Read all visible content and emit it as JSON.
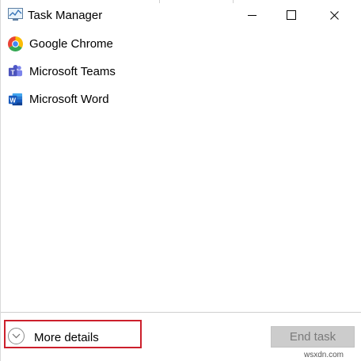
{
  "window": {
    "title": "Task Manager",
    "icon": "task-manager-icon"
  },
  "processes": [
    {
      "label": "Google Chrome",
      "icon": "chrome-icon"
    },
    {
      "label": "Microsoft Teams",
      "icon": "teams-icon"
    },
    {
      "label": "Microsoft Word",
      "icon": "word-icon"
    }
  ],
  "footer": {
    "more_details_label": "More details",
    "end_task_label": "End task"
  },
  "watermark": "wsxdn.com",
  "colors": {
    "highlight": "#cc1f2b",
    "disabled_button": "#cccccc",
    "teams_purple": "#5059c9",
    "word_blue": "#2b579a"
  }
}
